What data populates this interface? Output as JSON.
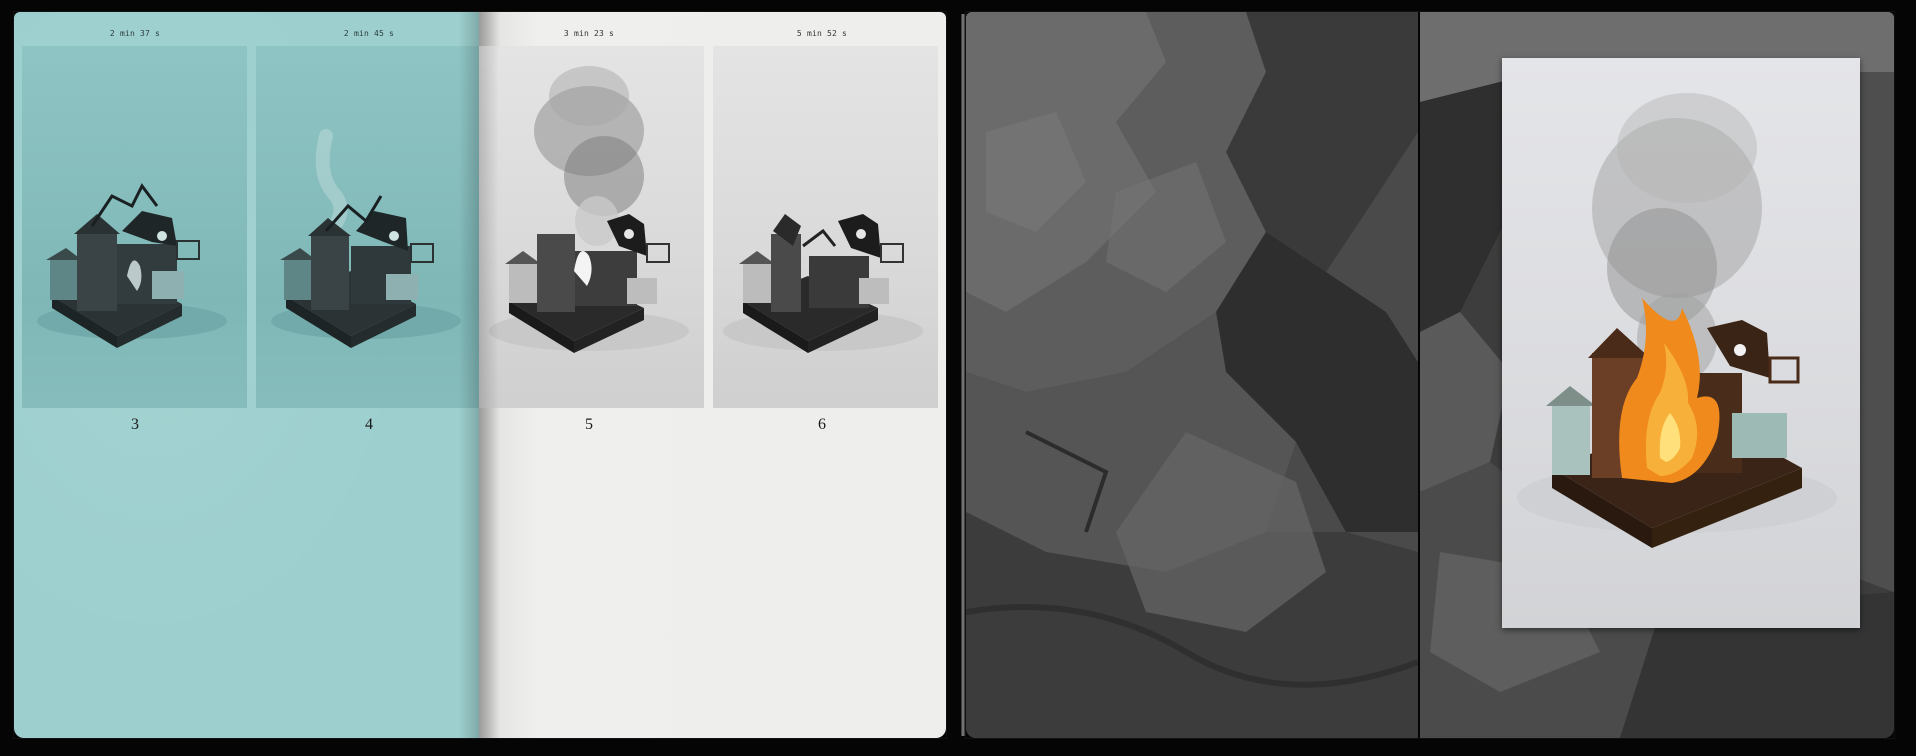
{
  "book": {
    "left_spread": {
      "plates": [
        {
          "timecode": "2 min 37 s",
          "number": "3"
        },
        {
          "timecode": "2 min 45 s",
          "number": "4"
        },
        {
          "timecode": "3 min 23 s",
          "number": "5"
        },
        {
          "timecode": "5 min 52 s",
          "number": "6"
        }
      ]
    },
    "colors": {
      "teal_paper": "#9ccfce",
      "white_paper": "#eeeeec",
      "background": "#050505",
      "fire": "#f08a1c"
    }
  }
}
